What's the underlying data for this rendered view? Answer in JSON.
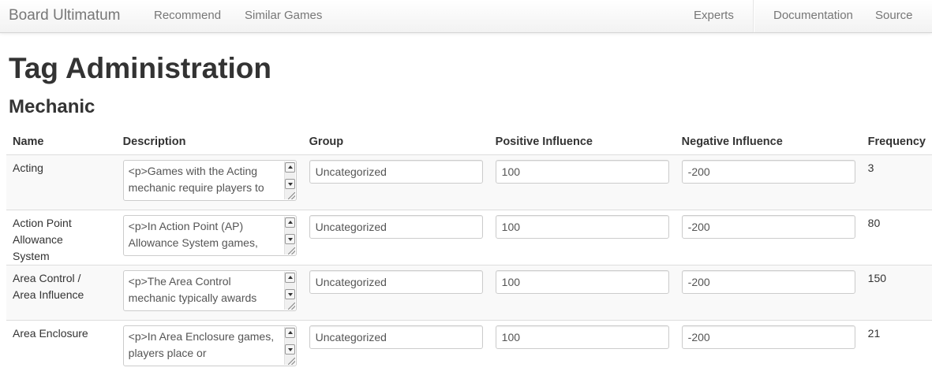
{
  "navbar": {
    "brand": "Board Ultimatum",
    "links_left": [
      "Recommend",
      "Similar Games"
    ],
    "links_right": [
      "Experts",
      "Documentation",
      "Source"
    ]
  },
  "page": {
    "title": "Tag Administration",
    "section": "Mechanic"
  },
  "table": {
    "headers": [
      "Name",
      "Description",
      "Group",
      "Positive Influence",
      "Negative Influence",
      "Frequency"
    ],
    "rows": [
      {
        "name": "Acting",
        "description": "<p>Games with the Acting mechanic require players to",
        "group": "Uncategorized",
        "positive": "100",
        "negative": "-200",
        "frequency": "3"
      },
      {
        "name": "Action Point Allowance System",
        "description": "<p>In Action Point (AP) Allowance System games,",
        "group": "Uncategorized",
        "positive": "100",
        "negative": "-200",
        "frequency": "80"
      },
      {
        "name": "Area Control / Area Influence",
        "description": "<p>The Area Control mechanic typically awards",
        "group": "Uncategorized",
        "positive": "100",
        "negative": "-200",
        "frequency": "150"
      },
      {
        "name": "Area Enclosure",
        "description": "<p>In Area Enclosure games, players place or",
        "group": "Uncategorized",
        "positive": "100",
        "negative": "-200",
        "frequency": "21"
      }
    ]
  }
}
